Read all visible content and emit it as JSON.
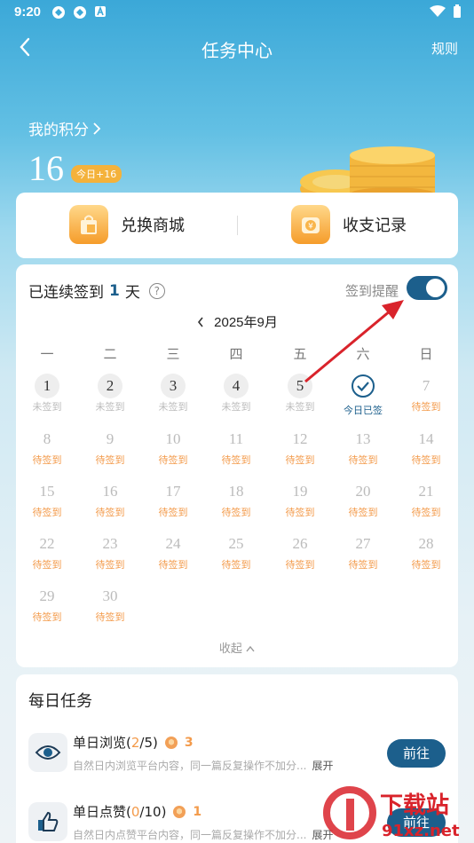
{
  "status_bar": {
    "time": "9:20"
  },
  "header": {
    "title": "任务中心",
    "rules": "规则"
  },
  "points": {
    "label": "我的积分",
    "value": "16",
    "today": "今日+16"
  },
  "shop": {
    "exchange_label": "兑换商城",
    "records_label": "收支记录"
  },
  "signin": {
    "title_prefix": "已连续签到",
    "days": "1",
    "title_suffix": "天",
    "help": "?",
    "remind_label": "签到提醒",
    "remind_on": true,
    "month": "2025年9月",
    "weekdays": [
      "一",
      "二",
      "三",
      "四",
      "五",
      "六",
      "日"
    ],
    "days_list": [
      {
        "num": "1",
        "status": "未签到"
      },
      {
        "num": "2",
        "status": "未签到"
      },
      {
        "num": "3",
        "status": "未签到"
      },
      {
        "num": "4",
        "status": "未签到"
      },
      {
        "num": "5",
        "status": "未签到"
      },
      {
        "num": "",
        "status": "今日已签"
      },
      {
        "num": "7",
        "status": "待签到"
      },
      {
        "num": "8",
        "status": "待签到"
      },
      {
        "num": "9",
        "status": "待签到"
      },
      {
        "num": "10",
        "status": "待签到"
      },
      {
        "num": "11",
        "status": "待签到"
      },
      {
        "num": "12",
        "status": "待签到"
      },
      {
        "num": "13",
        "status": "待签到"
      },
      {
        "num": "14",
        "status": "待签到"
      },
      {
        "num": "15",
        "status": "待签到"
      },
      {
        "num": "16",
        "status": "待签到"
      },
      {
        "num": "17",
        "status": "待签到"
      },
      {
        "num": "18",
        "status": "待签到"
      },
      {
        "num": "19",
        "status": "待签到"
      },
      {
        "num": "20",
        "status": "待签到"
      },
      {
        "num": "21",
        "status": "待签到"
      },
      {
        "num": "22",
        "status": "待签到"
      },
      {
        "num": "23",
        "status": "待签到"
      },
      {
        "num": "24",
        "status": "待签到"
      },
      {
        "num": "25",
        "status": "待签到"
      },
      {
        "num": "26",
        "status": "待签到"
      },
      {
        "num": "27",
        "status": "待签到"
      },
      {
        "num": "28",
        "status": "待签到"
      },
      {
        "num": "29",
        "status": "待签到"
      },
      {
        "num": "30",
        "status": "待签到"
      }
    ],
    "collapse": "收起"
  },
  "tasks": {
    "title": "每日任务",
    "items": [
      {
        "name": "单日浏览",
        "current": "2",
        "total": "/5",
        "reward": "3",
        "desc": "自然日内浏览平台内容，同一篇反复操作不加分...",
        "expand": "展开",
        "button": "前往",
        "icon": "eye-icon"
      },
      {
        "name": "单日点赞",
        "current": "0",
        "total": "/10",
        "reward": "1",
        "desc": "自然日内点赞平台内容，同一篇反复操作不加分...",
        "expand": "展开",
        "button": "前往",
        "icon": "thumbs-up-icon"
      }
    ]
  },
  "watermark": {
    "text_top": "下载站",
    "text_bottom": "91xz.net"
  },
  "colors": {
    "accent": "#1c5f8c",
    "orange": "#f39a4a"
  }
}
